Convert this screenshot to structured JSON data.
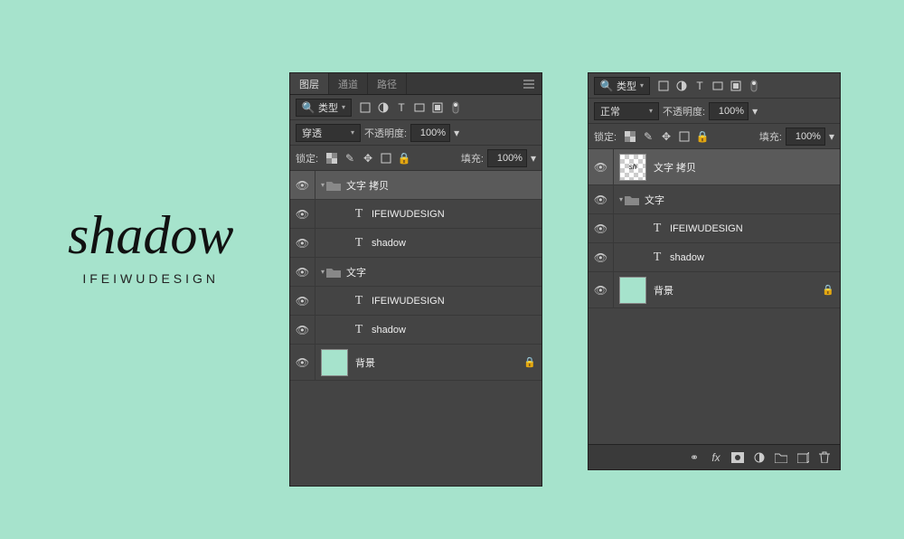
{
  "canvas": {
    "main": "shadow",
    "sub": "IFEIWUDESIGN"
  },
  "panels": {
    "tabs": {
      "layers": "图层",
      "channels": "通道",
      "paths": "路径"
    },
    "filter_label": "类型",
    "blend_normal": "正常",
    "blend_passthrough": "穿透",
    "opacity_label": "不透明度:",
    "fill_label": "填充:",
    "lock_label": "锁定:",
    "opacity_value": "100%",
    "fill_value": "100%"
  },
  "layers_left": {
    "group_copy": "文字 拷贝",
    "t1": "IFEIWUDESIGN",
    "t2": "shadow",
    "group_text": "文字",
    "t3": "IFEIWUDESIGN",
    "t4": "shadow",
    "bg": "背景"
  },
  "layers_right": {
    "smart_copy": "文字 拷贝",
    "group_text": "文字",
    "t1": "IFEIWUDESIGN",
    "t2": "shadow",
    "bg": "背景"
  }
}
